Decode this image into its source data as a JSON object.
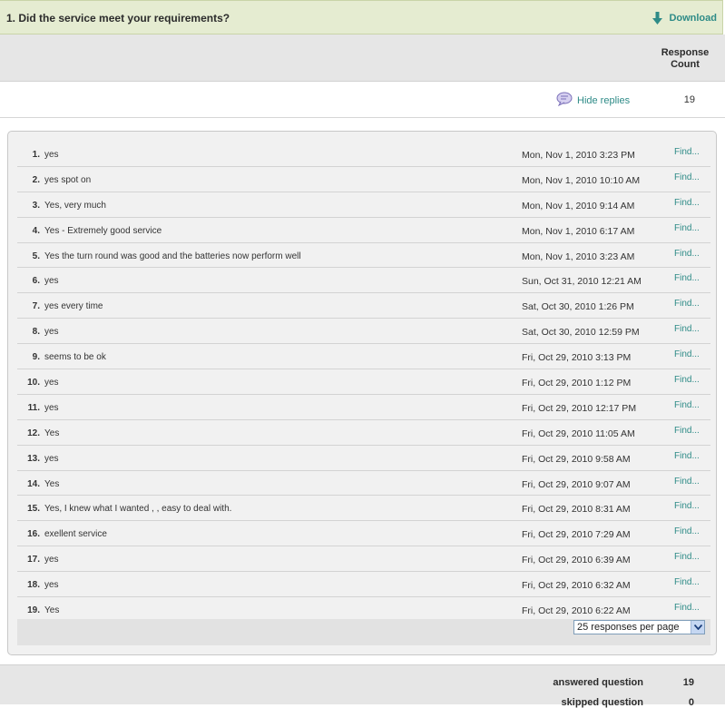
{
  "question": {
    "title": "1. Did the service meet your requirements?",
    "download_label": "Download"
  },
  "header": {
    "response_count_label": "Response Count"
  },
  "replies": {
    "hide_label": "Hide replies",
    "count": "19"
  },
  "responses": [
    {
      "num": "1.",
      "text": "yes",
      "date": "Mon, Nov 1, 2010 3:23 PM",
      "find": "Find..."
    },
    {
      "num": "2.",
      "text": "yes spot on",
      "date": "Mon, Nov 1, 2010 10:10 AM",
      "find": "Find..."
    },
    {
      "num": "3.",
      "text": "Yes, very much",
      "date": "Mon, Nov 1, 2010 9:14 AM",
      "find": "Find..."
    },
    {
      "num": "4.",
      "text": "Yes - Extremely good service",
      "date": "Mon, Nov 1, 2010 6:17 AM",
      "find": "Find..."
    },
    {
      "num": "5.",
      "text": "Yes the turn round was good and the batteries now perform well",
      "date": "Mon, Nov 1, 2010 3:23 AM",
      "find": "Find..."
    },
    {
      "num": "6.",
      "text": "yes",
      "date": "Sun, Oct 31, 2010 12:21 AM",
      "find": "Find..."
    },
    {
      "num": "7.",
      "text": "yes every time",
      "date": "Sat, Oct 30, 2010 1:26 PM",
      "find": "Find..."
    },
    {
      "num": "8.",
      "text": "yes",
      "date": "Sat, Oct 30, 2010 12:59 PM",
      "find": "Find..."
    },
    {
      "num": "9.",
      "text": "seems to be ok",
      "date": "Fri, Oct 29, 2010 3:13 PM",
      "find": "Find..."
    },
    {
      "num": "10.",
      "text": "yes",
      "date": "Fri, Oct 29, 2010 1:12 PM",
      "find": "Find..."
    },
    {
      "num": "11.",
      "text": "yes",
      "date": "Fri, Oct 29, 2010 12:17 PM",
      "find": "Find..."
    },
    {
      "num": "12.",
      "text": "Yes",
      "date": "Fri, Oct 29, 2010 11:05 AM",
      "find": "Find..."
    },
    {
      "num": "13.",
      "text": "yes",
      "date": "Fri, Oct 29, 2010 9:58 AM",
      "find": "Find..."
    },
    {
      "num": "14.",
      "text": "Yes",
      "date": "Fri, Oct 29, 2010 9:07 AM",
      "find": "Find..."
    },
    {
      "num": "15.",
      "text": "Yes, I knew what I wanted , , easy to deal with.",
      "date": "Fri, Oct 29, 2010 8:31 AM",
      "find": "Find..."
    },
    {
      "num": "16.",
      "text": "exellent service",
      "date": "Fri, Oct 29, 2010 7:29 AM",
      "find": "Find..."
    },
    {
      "num": "17.",
      "text": "yes",
      "date": "Fri, Oct 29, 2010 6:39 AM",
      "find": "Find..."
    },
    {
      "num": "18.",
      "text": "yes",
      "date": "Fri, Oct 29, 2010 6:32 AM",
      "find": "Find..."
    },
    {
      "num": "19.",
      "text": "Yes",
      "date": "Fri, Oct 29, 2010 6:22 AM",
      "find": "Find..."
    }
  ],
  "pager": {
    "selected": "25 responses per page"
  },
  "footer": {
    "answered_label": "answered question",
    "answered_value": "19",
    "skipped_label": "skipped question",
    "skipped_value": "0"
  },
  "icons": {
    "download": "down-arrow-icon",
    "hide_replies": "speech-bubble-icon",
    "select": "chevron-down-icon"
  },
  "colors": {
    "accent": "#2e8b87",
    "header_bg": "#e5ecd1",
    "panel_bg": "#f1f1f1"
  }
}
